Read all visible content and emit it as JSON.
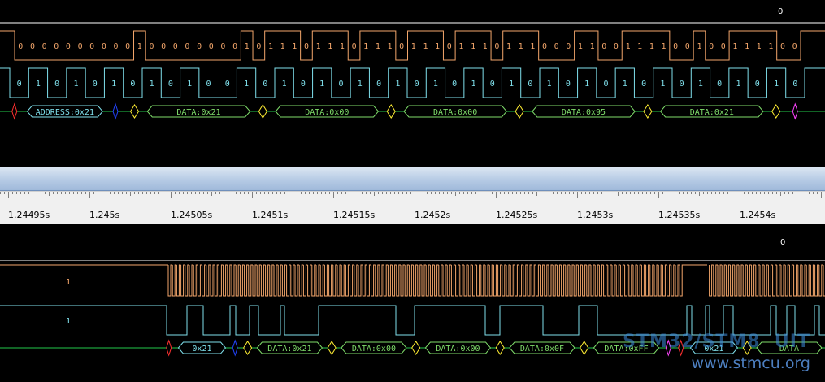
{
  "colors": {
    "sda": "#f3a66b",
    "scl": "#7fe0ec",
    "annotation": "#22c84a",
    "address_fill": "#7fe0ec",
    "data_fill": "#7fdc6a",
    "start": "#ff3030",
    "ack": "#ffee33",
    "nack": "#ff44ff",
    "rw": "#2244ff"
  },
  "top": {
    "corner_value": "0",
    "sda_bits": [
      "0",
      "0",
      "0",
      "0",
      "0",
      "0",
      "0",
      "0",
      "0",
      "0",
      "1",
      "0",
      "0",
      "0",
      "0",
      "0",
      "0",
      "0",
      "0",
      "1",
      "0",
      "1",
      "1",
      "1",
      "0",
      "1",
      "1",
      "1",
      "0",
      "1",
      "1",
      "1",
      "0",
      "1",
      "1",
      "1",
      "0",
      "1",
      "1",
      "1",
      "0",
      "1",
      "1",
      "1",
      "0",
      "0",
      "0",
      "1",
      "1",
      "0",
      "0",
      "1",
      "1",
      "1",
      "1",
      "0",
      "0",
      "1",
      "0",
      "0",
      "1",
      "1",
      "1",
      "1",
      "0",
      "0"
    ],
    "scl_bits": [
      "0",
      "1",
      "0",
      "1",
      "0",
      "1",
      "0",
      "1",
      "0",
      "1",
      "0",
      "0",
      "1",
      "0",
      "1",
      "0",
      "1",
      "0",
      "1",
      "0",
      "1",
      "0",
      "1",
      "0",
      "1",
      "0",
      "1",
      "0",
      "1",
      "0",
      "1",
      "0",
      "1",
      "0",
      "1",
      "0",
      "1",
      "0",
      "1",
      "0",
      "1",
      "0"
    ],
    "annotations": [
      {
        "type": "start"
      },
      {
        "type": "frame",
        "label": "ADDRESS:0x21",
        "kind": "address"
      },
      {
        "type": "rw"
      },
      {
        "type": "ack"
      },
      {
        "type": "frame",
        "label": "DATA:0x21",
        "kind": "data"
      },
      {
        "type": "ack"
      },
      {
        "type": "frame",
        "label": "DATA:0x00",
        "kind": "data"
      },
      {
        "type": "ack"
      },
      {
        "type": "frame",
        "label": "DATA:0x00",
        "kind": "data"
      },
      {
        "type": "ack"
      },
      {
        "type": "frame",
        "label": "DATA:0x95",
        "kind": "data"
      },
      {
        "type": "ack"
      },
      {
        "type": "frame",
        "label": "DATA:0x21",
        "kind": "data"
      },
      {
        "type": "ack"
      },
      {
        "type": "nack"
      }
    ]
  },
  "ruler": {
    "ticks": [
      "1.24495s",
      "1.245s",
      "1.24505s",
      "1.2451s",
      "1.24515s",
      "1.2452s",
      "1.24525s",
      "1.2453s",
      "1.24535s",
      "1.2454s"
    ]
  },
  "bottom": {
    "corner_value": "0",
    "sda_idle_label": "1",
    "scl_idle_label": "1",
    "annotations": [
      {
        "type": "start"
      },
      {
        "type": "frame",
        "label": "0x21",
        "kind": "address"
      },
      {
        "type": "rw"
      },
      {
        "type": "ack"
      },
      {
        "type": "frame",
        "label": "DATA:0x21",
        "kind": "data"
      },
      {
        "type": "ack"
      },
      {
        "type": "frame",
        "label": "DATA:0x00",
        "kind": "data"
      },
      {
        "type": "ack"
      },
      {
        "type": "frame",
        "label": "DATA:0x00",
        "kind": "data"
      },
      {
        "type": "ack"
      },
      {
        "type": "frame",
        "label": "DATA:0x0F",
        "kind": "data"
      },
      {
        "type": "ack"
      },
      {
        "type": "frame",
        "label": "DATA:0xFF",
        "kind": "data"
      },
      {
        "type": "nack"
      },
      {
        "type": "start"
      },
      {
        "type": "frame",
        "label": "0x21",
        "kind": "address"
      },
      {
        "type": "ack"
      },
      {
        "type": "frame",
        "label": "DATA",
        "kind": "data"
      }
    ]
  },
  "watermark": {
    "line1": "STM32/STM8  UIT",
    "line2": "www.stmcu.org"
  }
}
